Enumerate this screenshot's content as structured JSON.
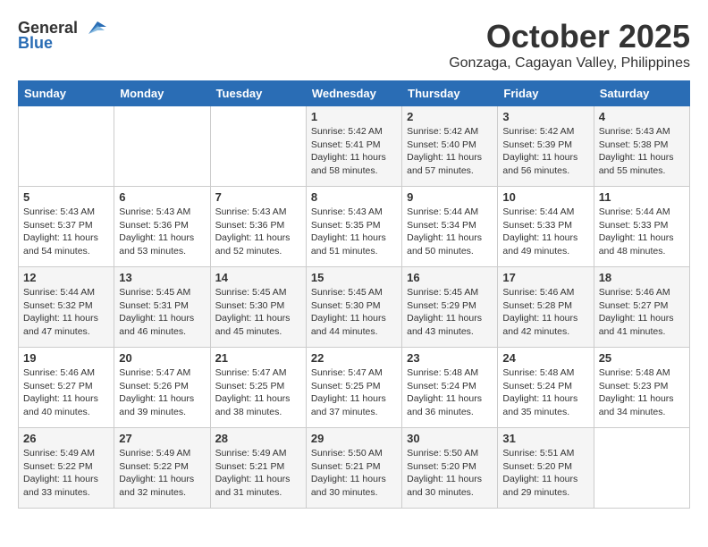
{
  "header": {
    "logo_general": "General",
    "logo_blue": "Blue",
    "month_title": "October 2025",
    "location": "Gonzaga, Cagayan Valley, Philippines"
  },
  "weekdays": [
    "Sunday",
    "Monday",
    "Tuesday",
    "Wednesday",
    "Thursday",
    "Friday",
    "Saturday"
  ],
  "weeks": [
    [
      {
        "day": "",
        "info": ""
      },
      {
        "day": "",
        "info": ""
      },
      {
        "day": "",
        "info": ""
      },
      {
        "day": "1",
        "info": "Sunrise: 5:42 AM\nSunset: 5:41 PM\nDaylight: 11 hours\nand 58 minutes."
      },
      {
        "day": "2",
        "info": "Sunrise: 5:42 AM\nSunset: 5:40 PM\nDaylight: 11 hours\nand 57 minutes."
      },
      {
        "day": "3",
        "info": "Sunrise: 5:42 AM\nSunset: 5:39 PM\nDaylight: 11 hours\nand 56 minutes."
      },
      {
        "day": "4",
        "info": "Sunrise: 5:43 AM\nSunset: 5:38 PM\nDaylight: 11 hours\nand 55 minutes."
      }
    ],
    [
      {
        "day": "5",
        "info": "Sunrise: 5:43 AM\nSunset: 5:37 PM\nDaylight: 11 hours\nand 54 minutes."
      },
      {
        "day": "6",
        "info": "Sunrise: 5:43 AM\nSunset: 5:36 PM\nDaylight: 11 hours\nand 53 minutes."
      },
      {
        "day": "7",
        "info": "Sunrise: 5:43 AM\nSunset: 5:36 PM\nDaylight: 11 hours\nand 52 minutes."
      },
      {
        "day": "8",
        "info": "Sunrise: 5:43 AM\nSunset: 5:35 PM\nDaylight: 11 hours\nand 51 minutes."
      },
      {
        "day": "9",
        "info": "Sunrise: 5:44 AM\nSunset: 5:34 PM\nDaylight: 11 hours\nand 50 minutes."
      },
      {
        "day": "10",
        "info": "Sunrise: 5:44 AM\nSunset: 5:33 PM\nDaylight: 11 hours\nand 49 minutes."
      },
      {
        "day": "11",
        "info": "Sunrise: 5:44 AM\nSunset: 5:33 PM\nDaylight: 11 hours\nand 48 minutes."
      }
    ],
    [
      {
        "day": "12",
        "info": "Sunrise: 5:44 AM\nSunset: 5:32 PM\nDaylight: 11 hours\nand 47 minutes."
      },
      {
        "day": "13",
        "info": "Sunrise: 5:45 AM\nSunset: 5:31 PM\nDaylight: 11 hours\nand 46 minutes."
      },
      {
        "day": "14",
        "info": "Sunrise: 5:45 AM\nSunset: 5:30 PM\nDaylight: 11 hours\nand 45 minutes."
      },
      {
        "day": "15",
        "info": "Sunrise: 5:45 AM\nSunset: 5:30 PM\nDaylight: 11 hours\nand 44 minutes."
      },
      {
        "day": "16",
        "info": "Sunrise: 5:45 AM\nSunset: 5:29 PM\nDaylight: 11 hours\nand 43 minutes."
      },
      {
        "day": "17",
        "info": "Sunrise: 5:46 AM\nSunset: 5:28 PM\nDaylight: 11 hours\nand 42 minutes."
      },
      {
        "day": "18",
        "info": "Sunrise: 5:46 AM\nSunset: 5:27 PM\nDaylight: 11 hours\nand 41 minutes."
      }
    ],
    [
      {
        "day": "19",
        "info": "Sunrise: 5:46 AM\nSunset: 5:27 PM\nDaylight: 11 hours\nand 40 minutes."
      },
      {
        "day": "20",
        "info": "Sunrise: 5:47 AM\nSunset: 5:26 PM\nDaylight: 11 hours\nand 39 minutes."
      },
      {
        "day": "21",
        "info": "Sunrise: 5:47 AM\nSunset: 5:25 PM\nDaylight: 11 hours\nand 38 minutes."
      },
      {
        "day": "22",
        "info": "Sunrise: 5:47 AM\nSunset: 5:25 PM\nDaylight: 11 hours\nand 37 minutes."
      },
      {
        "day": "23",
        "info": "Sunrise: 5:48 AM\nSunset: 5:24 PM\nDaylight: 11 hours\nand 36 minutes."
      },
      {
        "day": "24",
        "info": "Sunrise: 5:48 AM\nSunset: 5:24 PM\nDaylight: 11 hours\nand 35 minutes."
      },
      {
        "day": "25",
        "info": "Sunrise: 5:48 AM\nSunset: 5:23 PM\nDaylight: 11 hours\nand 34 minutes."
      }
    ],
    [
      {
        "day": "26",
        "info": "Sunrise: 5:49 AM\nSunset: 5:22 PM\nDaylight: 11 hours\nand 33 minutes."
      },
      {
        "day": "27",
        "info": "Sunrise: 5:49 AM\nSunset: 5:22 PM\nDaylight: 11 hours\nand 32 minutes."
      },
      {
        "day": "28",
        "info": "Sunrise: 5:49 AM\nSunset: 5:21 PM\nDaylight: 11 hours\nand 31 minutes."
      },
      {
        "day": "29",
        "info": "Sunrise: 5:50 AM\nSunset: 5:21 PM\nDaylight: 11 hours\nand 30 minutes."
      },
      {
        "day": "30",
        "info": "Sunrise: 5:50 AM\nSunset: 5:20 PM\nDaylight: 11 hours\nand 30 minutes."
      },
      {
        "day": "31",
        "info": "Sunrise: 5:51 AM\nSunset: 5:20 PM\nDaylight: 11 hours\nand 29 minutes."
      },
      {
        "day": "",
        "info": ""
      }
    ]
  ]
}
